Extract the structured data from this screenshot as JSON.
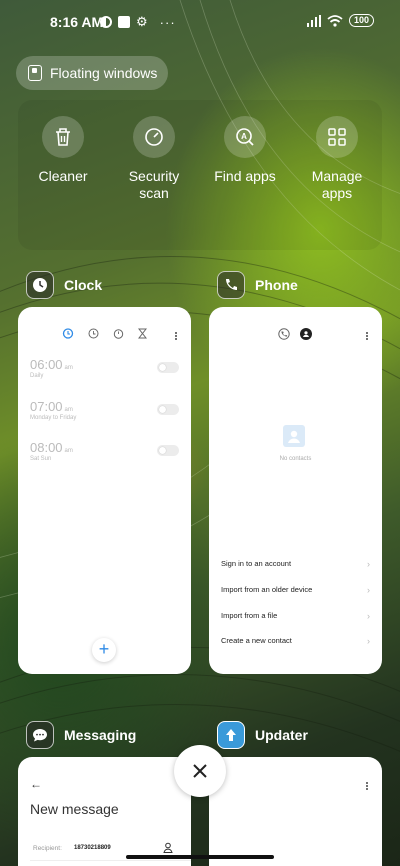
{
  "status_bar": {
    "time": "8:16 AM",
    "battery": "100"
  },
  "floating_windows_label": "Floating windows",
  "quick_actions": [
    {
      "label": "Cleaner",
      "icon": "trash-icon"
    },
    {
      "label": "Security scan",
      "icon": "shield-gauge-icon"
    },
    {
      "label": "Find apps",
      "icon": "search-app-icon"
    },
    {
      "label": "Manage apps",
      "icon": "grid-icon"
    }
  ],
  "recent_apps": {
    "clock": {
      "name": "Clock",
      "alarms": [
        {
          "time": "06:00",
          "ampm": "am",
          "repeat": "Daily"
        },
        {
          "time": "07:00",
          "ampm": "am",
          "repeat": "Monday to Friday"
        },
        {
          "time": "08:00",
          "ampm": "am",
          "repeat": "Sat Sun"
        }
      ],
      "add_label": "+"
    },
    "phone": {
      "name": "Phone",
      "empty_text": "No contacts",
      "options": [
        "Sign in to an account",
        "Import from an older device",
        "Import from a file",
        "Create a new contact"
      ]
    },
    "messaging": {
      "name": "Messaging",
      "title": "New message",
      "recipient_label": "Recipient:",
      "recipient_value": "18730218809"
    },
    "updater": {
      "name": "Updater"
    }
  },
  "colors": {
    "accent": "#2e8ae6",
    "updater_icon": "#3a9ad9"
  }
}
